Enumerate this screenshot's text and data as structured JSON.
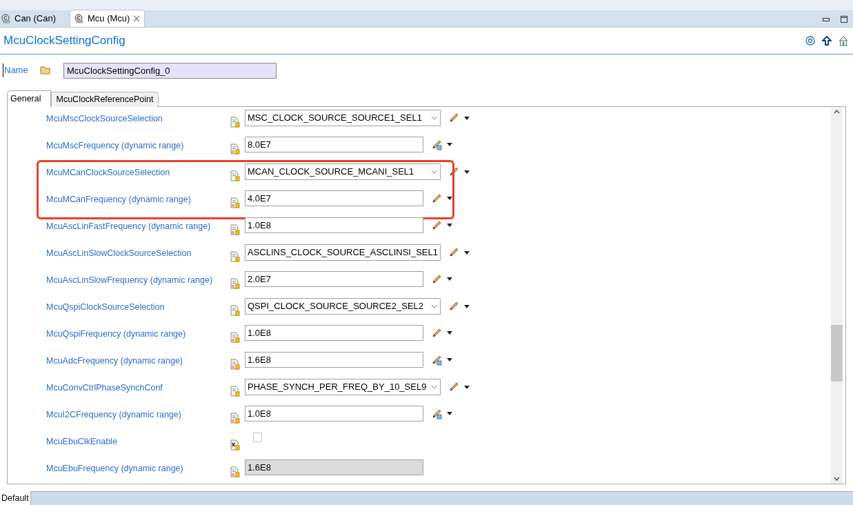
{
  "editor_tabs": [
    {
      "label": "Can (Can)",
      "selected": false,
      "closable": false
    },
    {
      "label": "Mcu (Mcu)",
      "selected": true,
      "closable": true
    }
  ],
  "form": {
    "title": "McuClockSettingConfig",
    "name_label": "Name",
    "name_value": "McuClockSettingConfig_0"
  },
  "sub_tabs": [
    {
      "label": "General",
      "selected": true
    },
    {
      "label": "McuClockReferencePoint",
      "selected": false
    }
  ],
  "rows": [
    {
      "label": "McuMscClockSourceSelection",
      "kind": "combo",
      "value": "MSC_CLOCK_SOURCE_SOURCE1_SEL1",
      "calculator": false,
      "highlighted": false
    },
    {
      "label": "McuMscFrequency (dynamic range)",
      "kind": "number",
      "value": "8.0E7",
      "calculator": true,
      "highlighted": false
    },
    {
      "label": "McuMCanClockSourceSelection",
      "kind": "combo",
      "value": "MCAN_CLOCK_SOURCE_MCANI_SEL1",
      "calculator": false,
      "highlighted": true
    },
    {
      "label": "McuMCanFrequency (dynamic range)",
      "kind": "number",
      "value": "4.0E7",
      "calculator": false,
      "highlighted": true
    },
    {
      "label": "McuAscLinFastFrequency (dynamic range)",
      "kind": "number",
      "value": "1.0E8",
      "calculator": false,
      "highlighted": false
    },
    {
      "label": "McuAscLinSlowClockSourceSelection",
      "kind": "combo",
      "value": "ASCLINS_CLOCK_SOURCE_ASCLINSI_SEL1",
      "calculator": false,
      "highlighted": false
    },
    {
      "label": "McuAscLinSlowFrequency (dynamic range)",
      "kind": "number",
      "value": "2.0E7",
      "calculator": false,
      "highlighted": false
    },
    {
      "label": "McuQspiClockSourceSelection",
      "kind": "combo",
      "value": "QSPI_CLOCK_SOURCE_SOURCE2_SEL2",
      "calculator": false,
      "highlighted": false
    },
    {
      "label": "McuQspiFrequency (dynamic range)",
      "kind": "number",
      "value": "1.0E8",
      "calculator": false,
      "highlighted": false
    },
    {
      "label": "McuAdcFrequency (dynamic range)",
      "kind": "number",
      "value": "1.6E8",
      "calculator": true,
      "highlighted": false
    },
    {
      "label": "McuConvCtrlPhaseSynchConf",
      "kind": "combo",
      "value": "PHASE_SYNCH_PER_FREQ_BY_10_SEL9",
      "calculator": false,
      "highlighted": false
    },
    {
      "label": "McuI2CFrequency (dynamic range)",
      "kind": "number",
      "value": "1.0E8",
      "calculator": true,
      "highlighted": false
    },
    {
      "label": "McuEbuClkEnable",
      "kind": "checkbox",
      "checked": false,
      "highlighted": false
    },
    {
      "label": "McuEbuFrequency (dynamic range)",
      "kind": "readonly",
      "value": "1.6E8",
      "highlighted": false
    }
  ],
  "status_bar": {
    "label": "Default"
  }
}
